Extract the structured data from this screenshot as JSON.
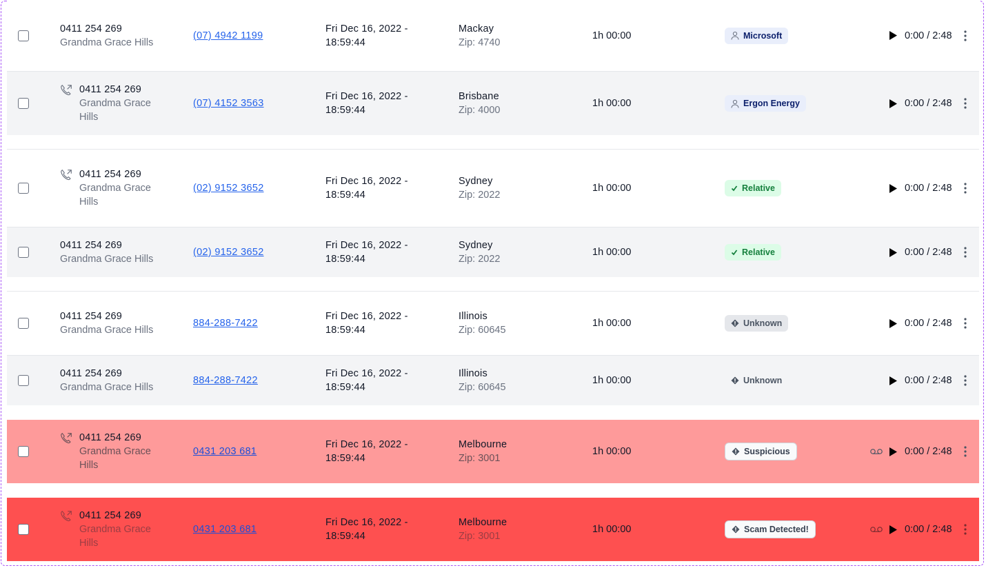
{
  "rows": [
    {
      "caller_number": "0411 254 269",
      "caller_name": "Grandma Grace Hills",
      "phone": "(07) 4942 1199",
      "date_line1": "Fri Dec 16, 2022 -",
      "date_line2": "18:59:44",
      "city": "Mackay",
      "zip": "Zip: 4740",
      "duration": "1h 00:00",
      "badge": "Microsoft",
      "badge_icon": "person-icon",
      "time": "0:00 / 2:48"
    },
    {
      "caller_number": "0411 254 269",
      "caller_name": "Grandma Grace Hills",
      "phone": "(07) 4152 3563",
      "date_line1": "Fri Dec 16, 2022 -",
      "date_line2": "18:59:44",
      "city": "Brisbane",
      "zip": "Zip: 4000",
      "duration": "1h 00:00",
      "badge": "Ergon Energy",
      "badge_icon": "person-icon",
      "time": "0:00 / 2:48"
    },
    {
      "caller_number": "0411 254 269",
      "caller_name": "Grandma Grace Hills",
      "phone": "(02) 9152 3652",
      "date_line1": "Fri Dec 16, 2022 -",
      "date_line2": "18:59:44",
      "city": "Sydney",
      "zip": "Zip: 2022",
      "duration": "1h 00:00",
      "badge": "Relative",
      "badge_icon": "check-icon",
      "time": "0:00 / 2:48"
    },
    {
      "caller_number": "0411 254 269",
      "caller_name": "Grandma Grace Hills",
      "phone": "(02) 9152 3652",
      "date_line1": "Fri Dec 16, 2022 -",
      "date_line2": "18:59:44",
      "city": "Sydney",
      "zip": "Zip: 2022",
      "duration": "1h 00:00",
      "badge": "Relative",
      "badge_icon": "check-icon",
      "time": "0:00 / 2:48"
    },
    {
      "caller_number": "0411 254 269",
      "caller_name": "Grandma Grace Hills",
      "phone": "884-288-7422",
      "date_line1": "Fri Dec 16, 2022 -",
      "date_line2": "18:59:44",
      "city": "Illinois",
      "zip": "Zip: 60645",
      "duration": "1h 00:00",
      "badge": "Unknown",
      "badge_icon": "diamond-alert-icon",
      "time": "0:00 / 2:48"
    },
    {
      "caller_number": "0411 254 269",
      "caller_name": "Grandma Grace Hills",
      "phone": "884-288-7422",
      "date_line1": "Fri Dec 16, 2022 -",
      "date_line2": "18:59:44",
      "city": "Illinois",
      "zip": "Zip: 60645",
      "duration": "1h 00:00",
      "badge": "Unknown",
      "badge_icon": "diamond-alert-icon",
      "time": "0:00 / 2:48"
    },
    {
      "caller_number": "0411 254 269",
      "caller_name": "Grandma Grace Hills",
      "phone": "0431 203 681",
      "date_line1": "Fri Dec 16, 2022 -",
      "date_line2": "18:59:44",
      "city": "Melbourne",
      "zip": "Zip: 3001",
      "duration": "1h 00:00",
      "badge": "Suspicious",
      "badge_icon": "diamond-alert-icon",
      "time": "0:00 / 2:48"
    },
    {
      "caller_number": "0411 254 269",
      "caller_name": "Grandma Grace Hills",
      "phone": "0431 203 681",
      "date_line1": "Fri Dec 16, 2022 -",
      "date_line2": "18:59:44",
      "city": "Melbourne",
      "zip": "Zip: 3001",
      "duration": "1h 00:00",
      "badge": "Scam Detected!",
      "badge_icon": "diamond-alert-icon",
      "time": "0:00 / 2:48"
    }
  ],
  "colors": {
    "suspicious_row": "#fe9a9a",
    "scam_row": "#fe5050",
    "link": "#2563eb",
    "frame_border": "#a855f7"
  }
}
